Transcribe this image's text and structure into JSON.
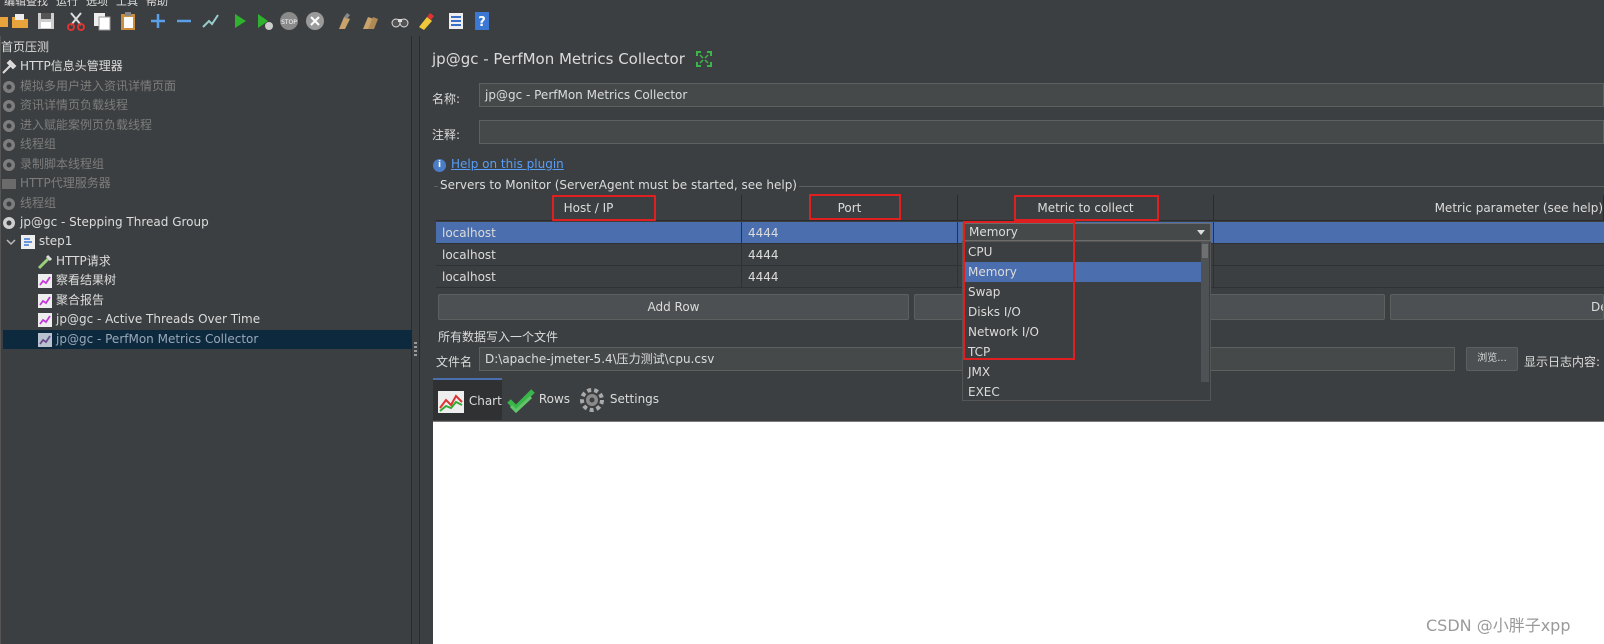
{
  "menubar": {
    "items": [
      "编辑",
      "查找",
      "运行",
      "选项",
      "工具",
      "帮助"
    ]
  },
  "toolbar": {
    "icons": [
      "open-icon",
      "save-icon",
      "cut-icon",
      "copy-icon",
      "paste-icon",
      "expand-all-icon",
      "collapse-all-icon",
      "toggle-icon",
      "start-icon",
      "start-no-pause-icon",
      "stop-icon",
      "shutdown-icon",
      "clear-icon",
      "clear-all-icon",
      "search-icon",
      "reset-search-icon",
      "function-helper-icon",
      "help-icon"
    ]
  },
  "tree": {
    "items": [
      {
        "label": "首页压测",
        "state": "root"
      },
      {
        "label": "HTTP信息头管理器",
        "state": "enabled"
      },
      {
        "label": "模拟多用户进入资讯详情页面",
        "state": "disabled"
      },
      {
        "label": "资讯详情页负载线程",
        "state": "disabled"
      },
      {
        "label": "进入赋能案例页负载线程",
        "state": "disabled"
      },
      {
        "label": "线程组",
        "state": "disabled"
      },
      {
        "label": "录制脚本线程组",
        "state": "disabled"
      },
      {
        "label": "HTTP代理服务器",
        "state": "disabled"
      },
      {
        "label": "线程组",
        "state": "disabled"
      },
      {
        "label": "jp@gc - Stepping Thread Group",
        "state": "enabled"
      },
      {
        "label": "step1",
        "state": "enabled"
      },
      {
        "label": "HTTP请求",
        "state": "enabled"
      },
      {
        "label": "察看结果树",
        "state": "enabled"
      },
      {
        "label": "聚合报告",
        "state": "enabled"
      },
      {
        "label": "jp@gc - Active Threads Over Time",
        "state": "enabled"
      },
      {
        "label": "jp@gc - PerfMon Metrics Collector",
        "state": "selected"
      }
    ]
  },
  "panel": {
    "title": "jp@gc - PerfMon Metrics Collector",
    "name_label": "名称:",
    "name_value": "jp@gc - PerfMon Metrics Collector",
    "comment_label": "注释:",
    "comment_value": "",
    "help_link": "Help on this plugin",
    "servers_legend": "Servers to Monitor (ServerAgent must be started, see help)"
  },
  "table": {
    "headers": [
      "Host / IP",
      "Port",
      "Metric to collect",
      "Metric parameter (see help)"
    ],
    "rows": [
      {
        "host": "localhost",
        "port": "4444",
        "metric": "Memory",
        "param": ""
      },
      {
        "host": "localhost",
        "port": "4444",
        "metric": "",
        "param": ""
      },
      {
        "host": "localhost",
        "port": "4444",
        "metric": "",
        "param": ""
      }
    ]
  },
  "dropdown": {
    "selected": "Memory",
    "options": [
      "CPU",
      "Memory",
      "Swap",
      "Disks I/O",
      "Network I/O",
      "TCP",
      "JMX",
      "EXEC"
    ]
  },
  "buttons": {
    "add_row": "Add Row",
    "delete_partial": "De"
  },
  "file": {
    "legend": "所有数据写入一个文件",
    "label": "文件名",
    "value": "D:\\apache-jmeter-5.4\\压力测试\\cpu.csv",
    "browse": "浏览...",
    "log_label": "显示日志内容:"
  },
  "tabs": [
    "Chart",
    "Rows",
    "Settings"
  ],
  "watermark": "CSDN @小胖子xpp",
  "colors": {
    "selection": "#4b6eaf",
    "annotation": "#e02020",
    "link": "#589df6"
  }
}
